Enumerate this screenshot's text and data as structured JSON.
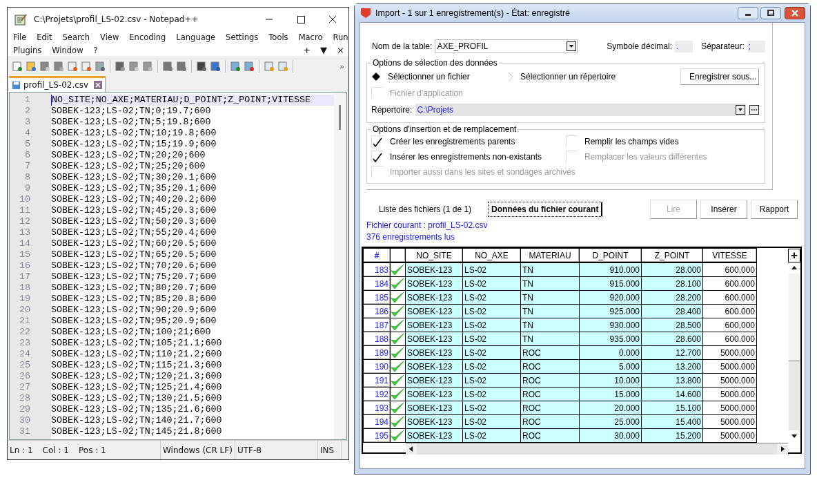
{
  "notepad": {
    "title": "C:\\Projets\\profil_LS-02.csv - Notepad++",
    "menu_rows": [
      [
        "File",
        "Edit",
        "Search",
        "View",
        "Encoding",
        "Language",
        "Settings",
        "Tools",
        "Macro",
        "Run"
      ],
      [
        "Plugins",
        "Window",
        "?"
      ]
    ],
    "menu_controls": [
      "+",
      "▼",
      "×"
    ],
    "toolbar_more": "»",
    "tab": {
      "label": "profil_LS-02.csv"
    },
    "lines": [
      {
        "num": "1",
        "text": "NO_SITE;NO_AXE;MATERIAU;D_POINT;Z_POINT;VITESSE",
        "current": true
      },
      {
        "num": "2",
        "text": "SOBEK-123;LS-02;TN;0;19.7;600",
        "current": false
      },
      {
        "num": "3",
        "text": "SOBEK-123;LS-02;TN;5;19.8;600",
        "current": false
      },
      {
        "num": "4",
        "text": "SOBEK-123;LS-02;TN;10;19.8;600",
        "current": false
      },
      {
        "num": "5",
        "text": "SOBEK-123;LS-02;TN;15;19.9;600",
        "current": false
      },
      {
        "num": "6",
        "text": "SOBEK-123;LS-02;TN;20;20;600",
        "current": false
      },
      {
        "num": "7",
        "text": "SOBEK-123;LS-02;TN;25;20;600",
        "current": false
      },
      {
        "num": "8",
        "text": "SOBEK-123;LS-02;TN;30;20.1;600",
        "current": false
      },
      {
        "num": "9",
        "text": "SOBEK-123;LS-02;TN;35;20.1;600",
        "current": false
      },
      {
        "num": "10",
        "text": "SOBEK-123;LS-02;TN;40;20.2;600",
        "current": false
      },
      {
        "num": "11",
        "text": "SOBEK-123;LS-02;TN;45;20.3;600",
        "current": false
      },
      {
        "num": "12",
        "text": "SOBEK-123;LS-02;TN;50;20.3;600",
        "current": false
      },
      {
        "num": "13",
        "text": "SOBEK-123;LS-02;TN;55;20.4;600",
        "current": false
      },
      {
        "num": "14",
        "text": "SOBEK-123;LS-02;TN;60;20.5;600",
        "current": false
      },
      {
        "num": "15",
        "text": "SOBEK-123;LS-02;TN;65;20.5;600",
        "current": false
      },
      {
        "num": "16",
        "text": "SOBEK-123;LS-02;TN;70;20.6;600",
        "current": false
      },
      {
        "num": "17",
        "text": "SOBEK-123;LS-02;TN;75;20.7;600",
        "current": false
      },
      {
        "num": "18",
        "text": "SOBEK-123;LS-02;TN;80;20.7;600",
        "current": false
      },
      {
        "num": "19",
        "text": "SOBEK-123;LS-02;TN;85;20.8;600",
        "current": false
      },
      {
        "num": "20",
        "text": "SOBEK-123;LS-02;TN;90;20.9;600",
        "current": false
      },
      {
        "num": "21",
        "text": "SOBEK-123;LS-02;TN;95;20.9;600",
        "current": false
      },
      {
        "num": "22",
        "text": "SOBEK-123;LS-02;TN;100;21;600",
        "current": false
      },
      {
        "num": "23",
        "text": "SOBEK-123;LS-02;TN;105;21.1;600",
        "current": false
      },
      {
        "num": "24",
        "text": "SOBEK-123;LS-02;TN;110;21.2;600",
        "current": false
      },
      {
        "num": "25",
        "text": "SOBEK-123;LS-02;TN;115;21.3;600",
        "current": false
      },
      {
        "num": "26",
        "text": "SOBEK-123;LS-02;TN;120;21.3;600",
        "current": false
      },
      {
        "num": "27",
        "text": "SOBEK-123;LS-02;TN;125;21.4;600",
        "current": false
      },
      {
        "num": "28",
        "text": "SOBEK-123;LS-02;TN;130;21.5;600",
        "current": false
      },
      {
        "num": "29",
        "text": "SOBEK-123;LS-02;TN;135;21.6;600",
        "current": false
      },
      {
        "num": "30",
        "text": "SOBEK-123;LS-02;TN;140;21.7;600",
        "current": false
      },
      {
        "num": "31",
        "text": "SOBEK-123;LS-02;TN;145;21.8;600",
        "current": false
      }
    ],
    "status_bar": {
      "position": [
        "Ln : 1",
        "Col : 1",
        "Pos : 1"
      ],
      "eol": "Windows (CR LF)",
      "encoding": "UTF-8",
      "mode": "INS"
    }
  },
  "import": {
    "title": "Import - 1 sur 1 enregistrement(s) - État: enregistré",
    "table_name": {
      "label": "Nom de la table:",
      "value": "AXE_PROFIL"
    },
    "decimal": {
      "label": "Symbole décimal:",
      "value": "."
    },
    "separator": {
      "label": "Séparateur:",
      "value": ";"
    },
    "selection_group": {
      "title": "Options de sélection des données",
      "radios": [
        {
          "label": "Sélectionner un fichier",
          "selected": true
        },
        {
          "label": "Sélectionner un répertoire",
          "selected": false
        }
      ],
      "save_as_button": "Enregistrer sous...",
      "app_file": {
        "label": "Fichier d'application",
        "checked": false,
        "disabled": true
      },
      "directory": {
        "label": "Répertoire:",
        "value": "C:\\Projets"
      }
    },
    "insert_group": {
      "title": "Options d'insertion et de remplacement",
      "options": [
        {
          "label": "Créer les enregistrements parents",
          "checked": true,
          "disabled": false
        },
        {
          "label": "Remplir les champs vides",
          "checked": false,
          "disabled": false
        },
        {
          "label": "Insérer les enregistrements non-existants",
          "checked": true,
          "disabled": false
        },
        {
          "label": "Remplacer les valeurs différentes",
          "checked": false,
          "disabled": true
        },
        {
          "label": "Importer aussi dans les sites et sondages archivés",
          "checked": false,
          "disabled": true
        }
      ]
    },
    "tabs": [
      {
        "label": "Liste des fichiers (1 de 1)",
        "selected": false
      },
      {
        "label": "Données du fichier courant",
        "selected": true
      }
    ],
    "buttons": [
      {
        "label": "Lire",
        "disabled": true
      },
      {
        "label": "Insérer",
        "disabled": false
      },
      {
        "label": "Rapport",
        "disabled": false
      }
    ],
    "current_file": "Fichier courant : profil_LS-02.csv",
    "records_read": "376 enregistrements lus",
    "grid": {
      "number_header": "#",
      "columns": [
        "NO_SITE",
        "NO_AXE",
        "MATERIAU",
        "D_POINT",
        "Z_POINT",
        "VITESSE"
      ],
      "add_button": "+",
      "rows": [
        {
          "num": "183",
          "ok": true,
          "cells": [
            "SOBEK-123",
            "LS-02",
            "TN",
            "910.000",
            "28.000",
            "600.000"
          ]
        },
        {
          "num": "184",
          "ok": true,
          "cells": [
            "SOBEK-123",
            "LS-02",
            "TN",
            "915.000",
            "28.100",
            "600.000"
          ]
        },
        {
          "num": "185",
          "ok": true,
          "cells": [
            "SOBEK-123",
            "LS-02",
            "TN",
            "920.000",
            "28.200",
            "600.000"
          ]
        },
        {
          "num": "186",
          "ok": true,
          "cells": [
            "SOBEK-123",
            "LS-02",
            "TN",
            "925.000",
            "28.400",
            "600.000"
          ]
        },
        {
          "num": "187",
          "ok": true,
          "cells": [
            "SOBEK-123",
            "LS-02",
            "TN",
            "930.000",
            "28.500",
            "600.000"
          ]
        },
        {
          "num": "188",
          "ok": true,
          "cells": [
            "SOBEK-123",
            "LS-02",
            "TN",
            "935.000",
            "28.600",
            "600.000"
          ]
        },
        {
          "num": "189",
          "ok": true,
          "cells": [
            "SOBEK-123",
            "LS-02",
            "ROC",
            "0.000",
            "12.700",
            "5000.000"
          ]
        },
        {
          "num": "190",
          "ok": true,
          "cells": [
            "SOBEK-123",
            "LS-02",
            "ROC",
            "5.000",
            "13.200",
            "5000.000"
          ]
        },
        {
          "num": "191",
          "ok": true,
          "cells": [
            "SOBEK-123",
            "LS-02",
            "ROC",
            "10.000",
            "13.800",
            "5000.000"
          ]
        },
        {
          "num": "192",
          "ok": true,
          "cells": [
            "SOBEK-123",
            "LS-02",
            "ROC",
            "15.000",
            "14.600",
            "5000.000"
          ]
        },
        {
          "num": "193",
          "ok": true,
          "cells": [
            "SOBEK-123",
            "LS-02",
            "ROC",
            "20.000",
            "15.100",
            "5000.000"
          ]
        },
        {
          "num": "194",
          "ok": true,
          "cells": [
            "SOBEK-123",
            "LS-02",
            "ROC",
            "25.000",
            "15.400",
            "5000.000"
          ]
        },
        {
          "num": "195",
          "ok": true,
          "cells": [
            "SOBEK-123",
            "LS-02",
            "ROC",
            "30.000",
            "15.200",
            "5000.000"
          ]
        }
      ]
    }
  }
}
